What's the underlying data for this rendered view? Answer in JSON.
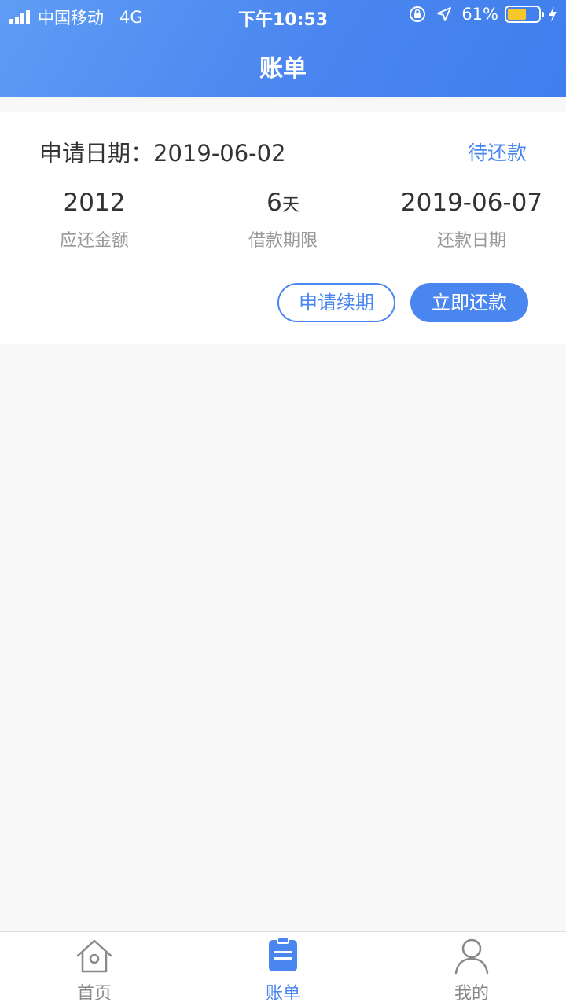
{
  "status_bar": {
    "carrier": "中国移动",
    "network": "4G",
    "time": "下午10:53",
    "battery_percent": "61%",
    "battery_level": 0.61
  },
  "nav": {
    "title": "账单"
  },
  "bill": {
    "apply_date_label": "申请日期：",
    "apply_date": "2019-06-02",
    "status": "待还款",
    "amount_value": "2012",
    "amount_label": "应还金额",
    "term_value": "6",
    "term_unit": "天",
    "term_label": "借款期限",
    "due_date_value": "2019-06-07",
    "due_date_label": "还款日期",
    "renew_button": "申请续期",
    "repay_button": "立即还款"
  },
  "tabbar": {
    "items": [
      {
        "label": "首页",
        "icon": "home-icon",
        "active": false
      },
      {
        "label": "账单",
        "icon": "bill-icon",
        "active": true
      },
      {
        "label": "我的",
        "icon": "user-icon",
        "active": false
      }
    ]
  },
  "colors": {
    "accent": "#4a86ef",
    "header_gradient_start": "#5e9cf5",
    "header_gradient_end": "#3f7eee",
    "battery": "#f8c628"
  }
}
